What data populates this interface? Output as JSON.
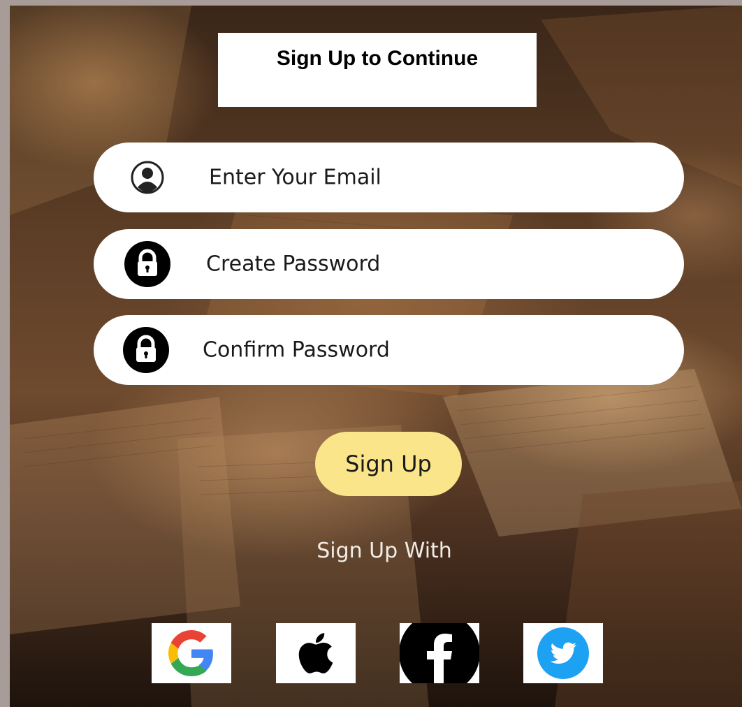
{
  "form": {
    "title": "Sign Up to Continue",
    "email_placeholder": "Enter Your Email",
    "create_password_placeholder": "Create Password",
    "confirm_password_placeholder": "Confirm Password",
    "signup_label": "Sign Up",
    "signup_with_label": "Sign Up With"
  },
  "icons": {
    "email": "user-icon",
    "create_password": "lock-icon",
    "confirm_password": "lock-icon"
  },
  "social": [
    {
      "icon": "google-icon"
    },
    {
      "icon": "apple-icon"
    },
    {
      "icon": "facebook-icon"
    },
    {
      "icon": "twitter-icon"
    }
  ],
  "colors": {
    "signup_button": "#fbe58a",
    "google_blue": "#4285F4",
    "google_red": "#EA4335",
    "google_yellow": "#FBBC05",
    "google_green": "#34A853",
    "twitter_blue": "#1DA1F2"
  }
}
